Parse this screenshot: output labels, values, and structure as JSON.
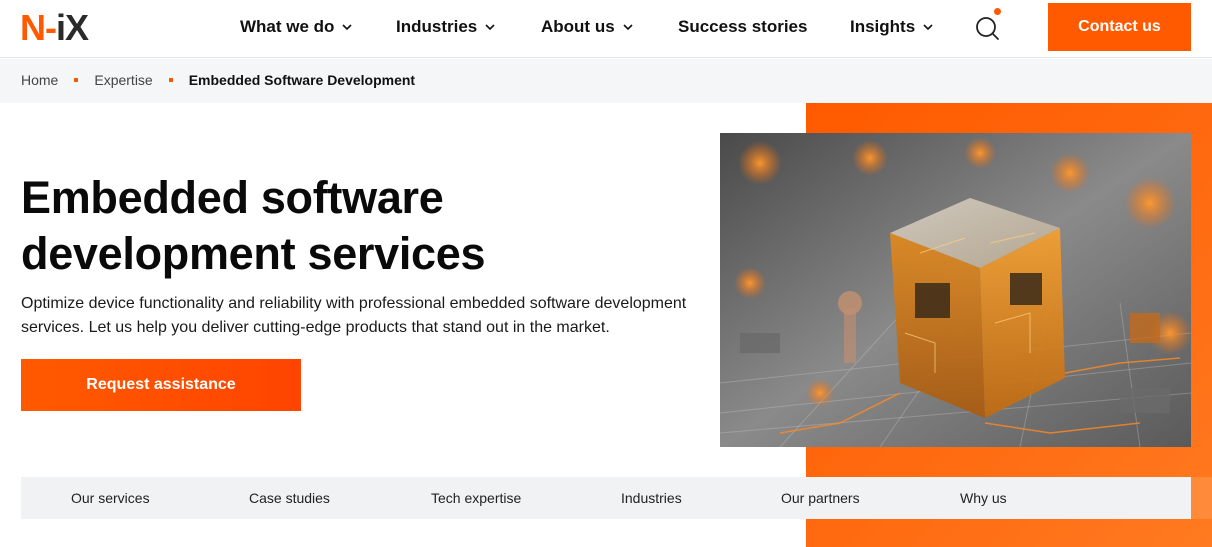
{
  "logo": {
    "n": "N",
    "dash": "-",
    "ix": "iX"
  },
  "nav": {
    "items": [
      {
        "label": "What we do",
        "dropdown": true
      },
      {
        "label": "Industries",
        "dropdown": true
      },
      {
        "label": "About us",
        "dropdown": true
      },
      {
        "label": "Success stories",
        "dropdown": false
      },
      {
        "label": "Insights",
        "dropdown": true
      }
    ],
    "search_icon": "search-icon",
    "contact_label": "Contact us"
  },
  "breadcrumb": {
    "items": [
      "Home",
      "Expertise",
      "Embedded Software Development"
    ]
  },
  "hero": {
    "title_line1": "Embedded software",
    "title_line2": "development services",
    "description_line1": "Optimize device functionality and reliability with professional embedded software development",
    "description_line2": "services. Let us help you deliver cutting-edge products that stand out in the market.",
    "cta_label": "Request assistance"
  },
  "subnav": {
    "items": [
      "Our services",
      "Case studies",
      "Tech expertise",
      "Industries",
      "Our partners",
      "Why us"
    ]
  },
  "colors": {
    "accent": "#ff5a00",
    "text": "#111111",
    "subnav_bg": "#f1f2f3",
    "breadcrumb_bg": "#f5f6f7"
  }
}
